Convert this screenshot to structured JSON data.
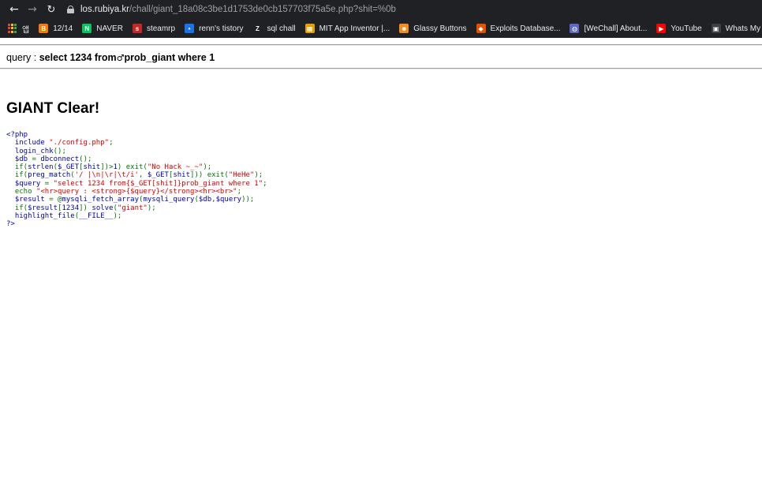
{
  "browser": {
    "url_host": "los.rubiya.kr",
    "url_path": "/chall/giant_18a08c3be1d1753de0cb157703f75a5e.php?shit=%0b",
    "back_glyph": "←",
    "forward_glyph": "→",
    "reload_glyph": "↻"
  },
  "bookmarks": [
    {
      "label": "앱",
      "icon": "apps-grid-icon",
      "color": "#8ab4f8",
      "glyph": ""
    },
    {
      "label": "12/14",
      "icon": "blogger-icon",
      "color": "#f57c00",
      "glyph": "B"
    },
    {
      "label": "NAVER",
      "icon": "naver-icon",
      "color": "#03c75a",
      "glyph": "N"
    },
    {
      "label": "steamrp",
      "icon": "steam-icon",
      "color": "#c62828",
      "glyph": "s"
    },
    {
      "label": "renn's tistory",
      "icon": "tistory-icon",
      "color": "#1a73e8",
      "glyph": "•"
    },
    {
      "label": "sql chall",
      "icon": "z-icon",
      "color": "#202124",
      "glyph": "Z"
    },
    {
      "label": "MIT App Inventor |...",
      "icon": "app-inventor-icon",
      "color": "#e0a100",
      "glyph": "▦"
    },
    {
      "label": "Glassy Buttons",
      "icon": "glassy-face-icon",
      "color": "#f28b20",
      "glyph": "☻"
    },
    {
      "label": "Exploits Database...",
      "icon": "exploit-db-icon",
      "color": "#e65100",
      "glyph": "◆"
    },
    {
      "label": "[WeChall] About...",
      "icon": "wechall-icon",
      "color": "#5c6bc0",
      "glyph": "◍"
    },
    {
      "label": "YouTube",
      "icon": "youtube-icon",
      "color": "#ff0000",
      "glyph": "▶"
    },
    {
      "label": "Whats My IP A...",
      "icon": "whatsmyip-icon",
      "color": "#3c4043",
      "glyph": "▣"
    }
  ],
  "page": {
    "query_label": "query : ",
    "query_before": "select 1234 from",
    "query_char": "♂",
    "query_after": "prob_giant where 1",
    "clear_text": "GIANT Clear!"
  },
  "source_code": [
    [
      [
        "php",
        "<?php"
      ]
    ],
    [
      [
        "g",
        "  "
      ],
      [
        "k",
        "include "
      ],
      [
        "s",
        "\"./config.php\""
      ],
      [
        "g",
        ";"
      ]
    ],
    [
      [
        "g",
        "  "
      ],
      [
        "k",
        "login_chk"
      ],
      [
        "g",
        "();"
      ]
    ],
    [
      [
        "g",
        "  "
      ],
      [
        "k",
        "$db "
      ],
      [
        "g",
        "= "
      ],
      [
        "k",
        "dbconnect"
      ],
      [
        "g",
        "();"
      ]
    ],
    [
      [
        "g",
        "  if("
      ],
      [
        "k",
        "strlen"
      ],
      [
        "g",
        "("
      ],
      [
        "k",
        "$_GET"
      ],
      [
        "g",
        "["
      ],
      [
        "k",
        "shit"
      ],
      [
        "g",
        "])>"
      ],
      [
        "k",
        "1"
      ],
      [
        "g",
        ") exit("
      ],
      [
        "s",
        "\"No Hack ~_~\""
      ],
      [
        "g",
        ");"
      ]
    ],
    [
      [
        "g",
        "  if("
      ],
      [
        "k",
        "preg_match"
      ],
      [
        "g",
        "("
      ],
      [
        "s",
        "'/ |\\n|\\r|\\t/i'"
      ],
      [
        "g",
        ", "
      ],
      [
        "k",
        "$_GET"
      ],
      [
        "g",
        "["
      ],
      [
        "k",
        "shit"
      ],
      [
        "g",
        "])) exit("
      ],
      [
        "s",
        "\"HeHe\""
      ],
      [
        "g",
        ");"
      ]
    ],
    [
      [
        "g",
        "  "
      ],
      [
        "k",
        "$query "
      ],
      [
        "g",
        "= "
      ],
      [
        "s",
        "\"select 1234 from{$_GET[shit]}prob_giant where 1\""
      ],
      [
        "g",
        ";"
      ]
    ],
    [
      [
        "g",
        "  echo "
      ],
      [
        "s",
        "\"<hr>query : <strong>{$query}</strong><hr><br>\""
      ],
      [
        "g",
        ";"
      ]
    ],
    [
      [
        "g",
        "  "
      ],
      [
        "k",
        "$result "
      ],
      [
        "g",
        "= @"
      ],
      [
        "k",
        "mysqli_fetch_array"
      ],
      [
        "g",
        "("
      ],
      [
        "k",
        "mysqli_query"
      ],
      [
        "g",
        "("
      ],
      [
        "k",
        "$db"
      ],
      [
        "g",
        ","
      ],
      [
        "k",
        "$query"
      ],
      [
        "g",
        "));"
      ]
    ],
    [
      [
        "g",
        "  if("
      ],
      [
        "k",
        "$result"
      ],
      [
        "g",
        "["
      ],
      [
        "k",
        "1234"
      ],
      [
        "g",
        "]) "
      ],
      [
        "k",
        "solve"
      ],
      [
        "g",
        "("
      ],
      [
        "s",
        "\"giant\""
      ],
      [
        "g",
        ");"
      ]
    ],
    [
      [
        "g",
        "  "
      ],
      [
        "k",
        "highlight_file"
      ],
      [
        "g",
        "("
      ],
      [
        "k",
        "__FILE__"
      ],
      [
        "g",
        ");"
      ]
    ],
    [
      [
        "php",
        "?>"
      ]
    ]
  ]
}
